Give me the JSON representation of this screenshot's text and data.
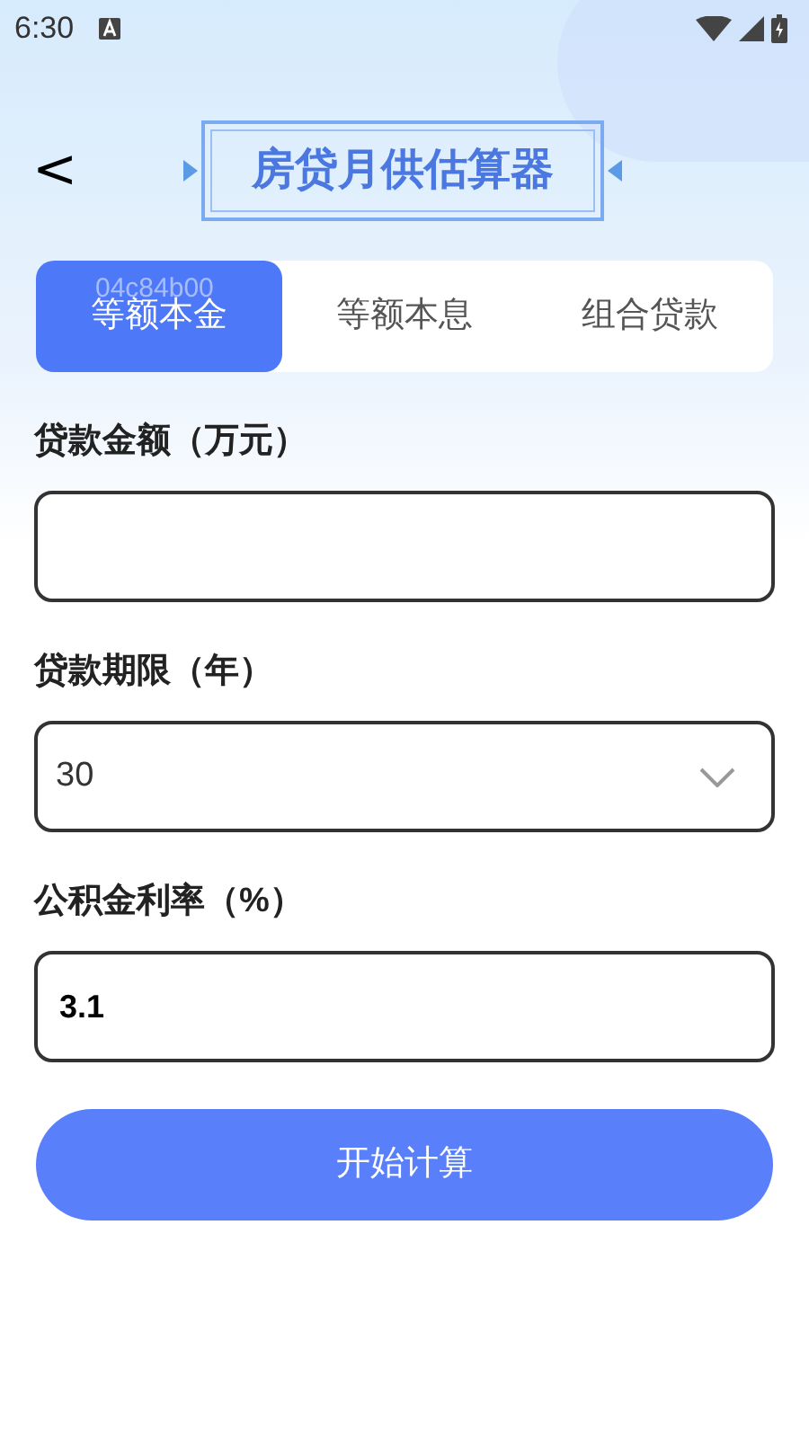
{
  "status_bar": {
    "time": "6:30"
  },
  "header": {
    "back": "<",
    "title": "房贷月供估算器"
  },
  "tabs": [
    {
      "label": "等额本金",
      "selected": true,
      "overlay": "04c84b00"
    },
    {
      "label": "等额本息",
      "selected": false
    },
    {
      "label": "组合贷款",
      "selected": false
    }
  ],
  "fields": [
    {
      "kind": "input",
      "label": "贷款金额（万元）"
    },
    {
      "kind": "select",
      "label": "贷款期限（年）",
      "value": "30"
    },
    {
      "kind": "input",
      "label": "公积金利率（%）",
      "value": "3.1"
    }
  ],
  "button": "开始计算"
}
